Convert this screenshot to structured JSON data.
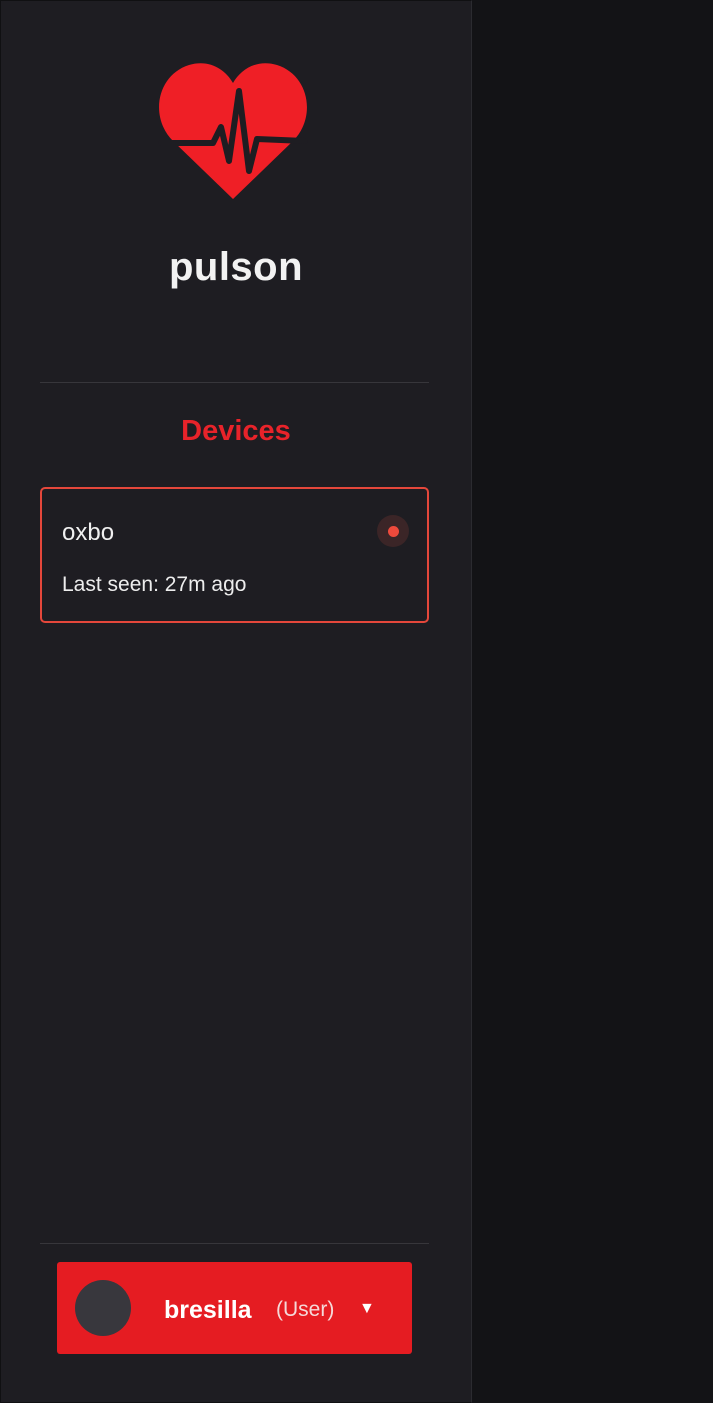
{
  "app": {
    "name": "pulson",
    "accent_color": "#e51c22",
    "logo_icon": "heart-pulse-icon"
  },
  "drawer": {
    "section_title": "Devices",
    "devices": [
      {
        "name": "oxbo",
        "last_seen": "Last seen: 27m ago",
        "status_color": "#ee4a3c"
      }
    ],
    "user": {
      "name": "bresilla",
      "role": "(User)",
      "menu_caret": "▼"
    }
  }
}
